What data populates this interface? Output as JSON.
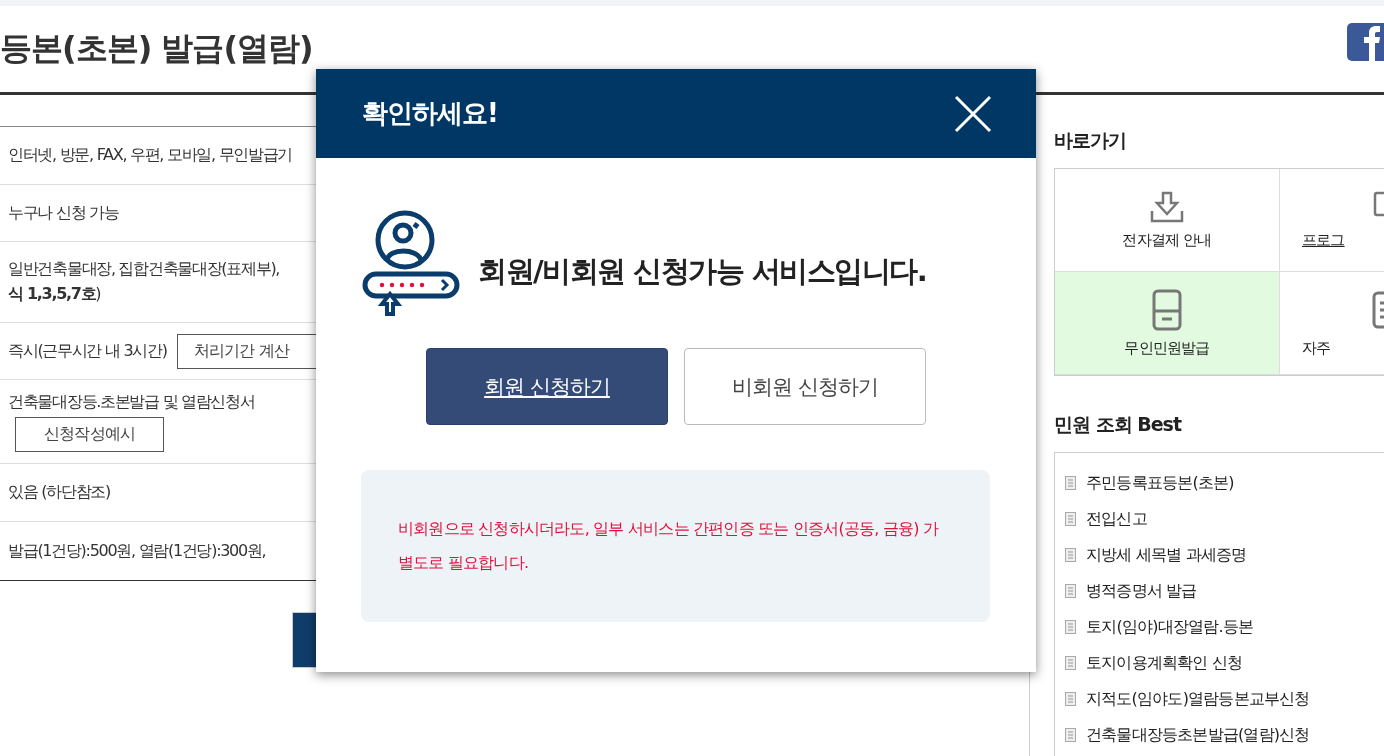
{
  "page_title": "등본(초본) 발급(열람)",
  "info_rows": [
    {
      "text": "인터넷, 방문, FAX, 우편, 모바일, 무인발급기"
    },
    {
      "text": "누구나 신청 가능"
    },
    {
      "text": "일반건축물대장, 집합건축물대장(표제부),",
      "text_2": "**식 1,3,5,7호**)"
    },
    {
      "text": "즉시(근무시간 내 3시간)",
      "button": "처리기간 계산"
    },
    {
      "text": "건축물대장등.초본발급 및 열람신청서",
      "button": "신청작성예시"
    },
    {
      "text": "있음 (하단참조)"
    },
    {
      "text": "발급(1건당):500원, 열람(1건당):300원,"
    }
  ],
  "shortcuts": {
    "title": "바로가기",
    "items": [
      {
        "label": "전자결제 안내",
        "selected": false
      },
      {
        "label": "프로그",
        "selected": false
      },
      {
        "label": "무인민원발급",
        "selected": true
      },
      {
        "label": "자주",
        "selected": false
      }
    ]
  },
  "best": {
    "title": "민원 조회 Best",
    "items": [
      "주민등록표등본(초본)",
      "전입신고",
      "지방세 세목별 과세증명",
      "병적증명서 발급",
      "토지(임야)대장열람.등본",
      "토지이용계획확인 신청",
      "지적도(임야도)열람등본교부신청",
      "건축물대장등초본발급(열람)신청"
    ]
  },
  "modal": {
    "title": "확인하세요!",
    "message": "회원/비회원 신청가능 서비스입니다.",
    "buttons": [
      {
        "label": "회원 신청하기",
        "kind": "primary"
      },
      {
        "label": "비회원 신청하기",
        "kind": "secondary"
      }
    ],
    "notice": "비회원으로 신청하시더라도, 일부 서비스는 간편인증 또는 인증서(공동, 금융) 가 별도로 필요합니다."
  }
}
